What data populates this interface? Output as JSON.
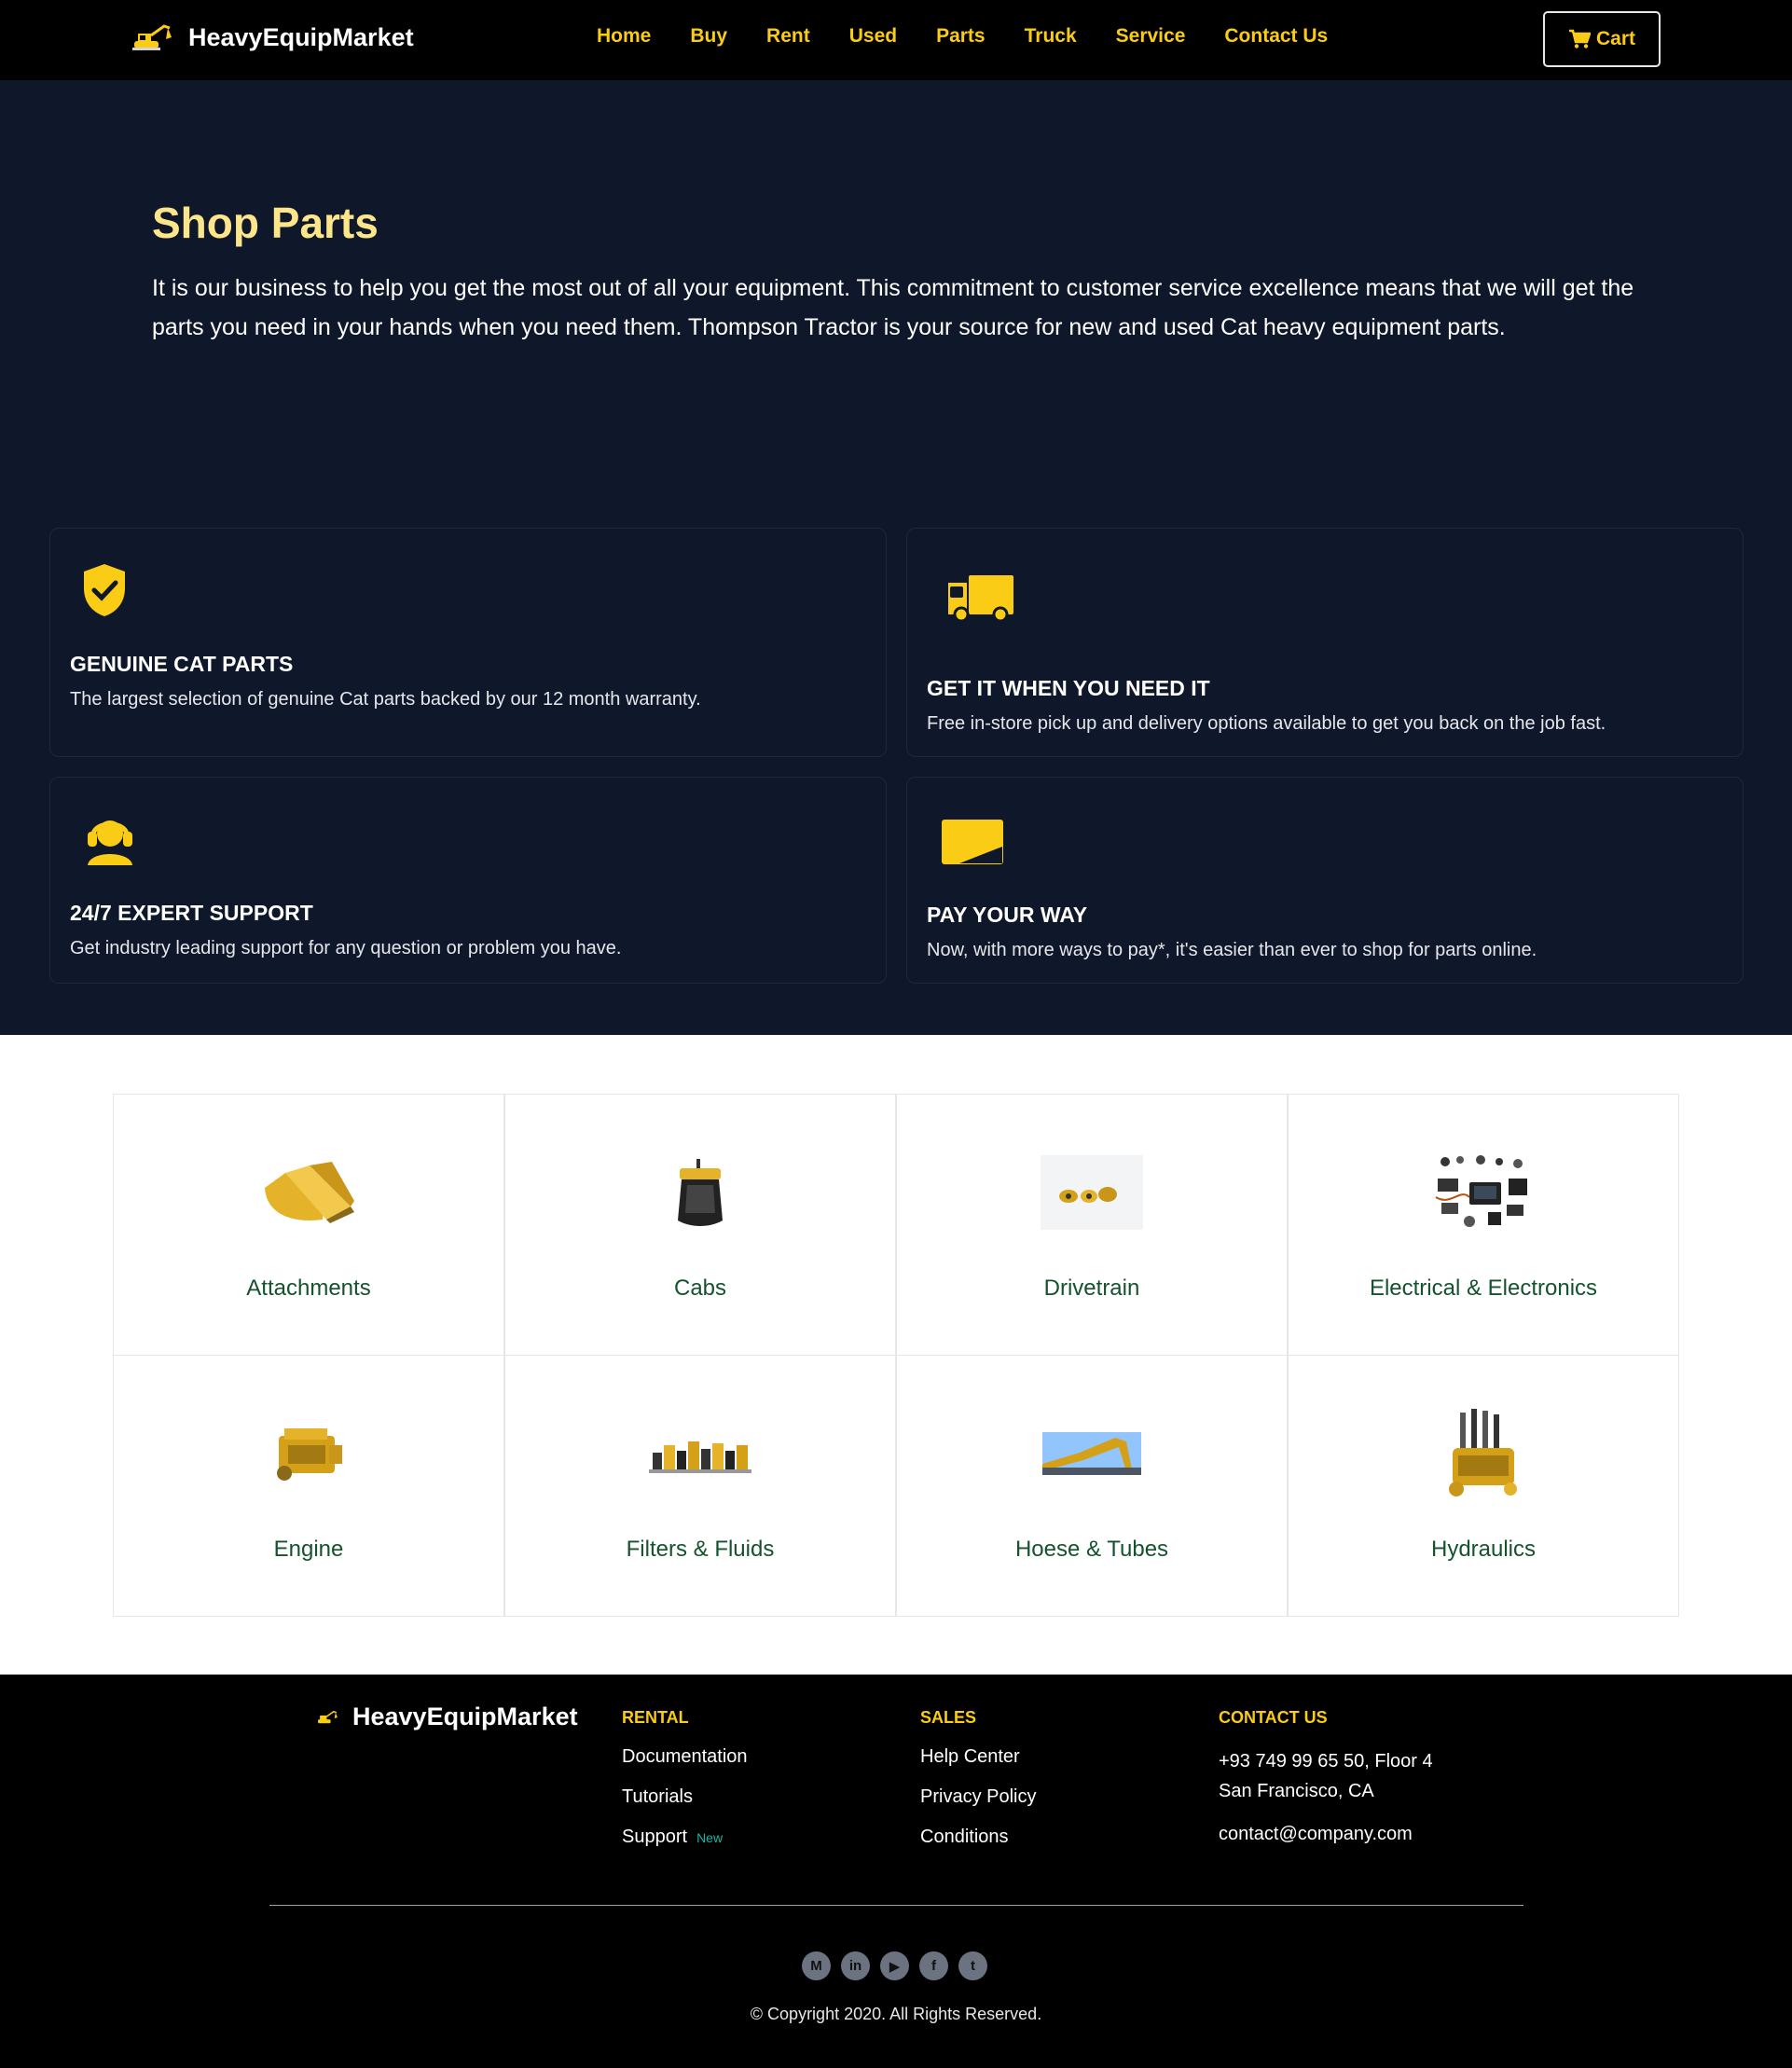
{
  "nav": {
    "brand": "HeavyEquipMarket",
    "links": [
      "Home",
      "Buy",
      "Rent",
      "Used",
      "Parts",
      "Truck",
      "Service",
      "Contact Us"
    ],
    "cart_label": "Cart"
  },
  "hero": {
    "title": "Shop Parts",
    "text": "It is our business to help you get the most out of all your equipment. This commitment to customer service excellence means that we will get the parts you need in your hands when you need them. Thompson Tractor is your source for new and used Cat heavy equipment parts."
  },
  "features": [
    {
      "title": "GENUINE CAT PARTS",
      "desc": "The largest selection of genuine Cat parts backed by our 12 month warranty.",
      "icon": "shield-check-icon"
    },
    {
      "title": "GET IT WHEN YOU NEED IT",
      "desc": "Free in-store pick up and delivery options available to get you back on the job fast.",
      "icon": "truck-icon"
    },
    {
      "title": "24/7 EXPERT SUPPORT",
      "desc": "Get industry leading support for any question or problem you have.",
      "icon": "headset-icon"
    },
    {
      "title": "PAY YOUR WAY",
      "desc": "Now, with more ways to pay*, it's easier than ever to shop for parts online.",
      "icon": "card-icon"
    }
  ],
  "categories": [
    {
      "label": "Attachments"
    },
    {
      "label": "Cabs"
    },
    {
      "label": "Drivetrain"
    },
    {
      "label": "Electrical & Electronics"
    },
    {
      "label": "Engine"
    },
    {
      "label": "Filters & Fluids"
    },
    {
      "label": "Hoese & Tubes"
    },
    {
      "label": "Hydraulics"
    }
  ],
  "footer": {
    "brand": "HeavyEquipMarket",
    "rental": {
      "heading": "RENTAL",
      "items": [
        "Documentation",
        "Tutorials",
        "Support"
      ],
      "badge": "New"
    },
    "sales": {
      "heading": "SALES",
      "items": [
        "Help Center",
        "Privacy Policy",
        "Conditions"
      ]
    },
    "contact": {
      "heading": "CONTACT US",
      "address1": "+93 749 99 65 50, Floor 4",
      "address2": "San Francisco, CA",
      "email": "contact@company.com"
    },
    "socials": [
      "M",
      "in",
      "▶",
      "f",
      "t"
    ],
    "copyright": "© Copyright 2020. All Rights Reserved."
  },
  "colors": {
    "accent": "#facc15",
    "hero_bg": "#0f172a",
    "nav_bg": "#000000",
    "category_label": "#14532d"
  }
}
